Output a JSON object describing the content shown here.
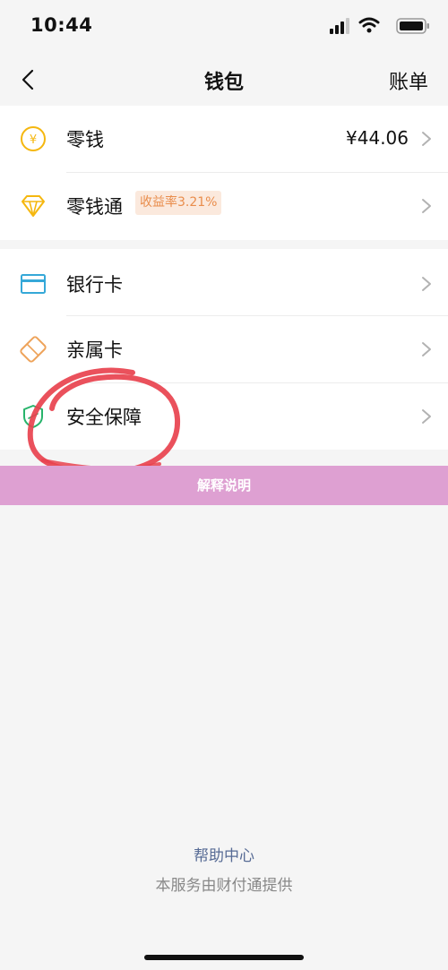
{
  "status_bar": {
    "time": "10:44",
    "icons": [
      "signal-icon",
      "wifi-icon",
      "battery-icon"
    ]
  },
  "nav": {
    "title": "钱包",
    "bill_label": "账单",
    "back_icon": "chevron-left-icon"
  },
  "group1": {
    "change": {
      "label": "零钱",
      "value": "¥44.06",
      "icon": "yuan-coin-icon"
    },
    "change_fund": {
      "label": "零钱通",
      "badge": "收益率3.21%",
      "icon": "diamond-icon"
    }
  },
  "group2": {
    "bank_card": {
      "label": "银行卡",
      "icon": "bank-card-icon"
    },
    "family_card": {
      "label": "亲属卡",
      "icon": "family-card-icon"
    },
    "security": {
      "label": "安全保障",
      "icon": "shield-icon"
    }
  },
  "banner": {
    "text": "解释说明"
  },
  "footer": {
    "help": "帮助中心",
    "provider": "本服务由财付通提供"
  },
  "colors": {
    "accent_yellow": "#f5b70f",
    "card_blue": "#35a8d8",
    "family_orange": "#eea35a",
    "shield_green": "#27b46b",
    "badge_bg": "#fbe9dd",
    "badge_text": "#e98d4c",
    "banner_bg": "#dea0d2",
    "link_blue": "#576b95",
    "annotation_red": "#e8424e"
  }
}
